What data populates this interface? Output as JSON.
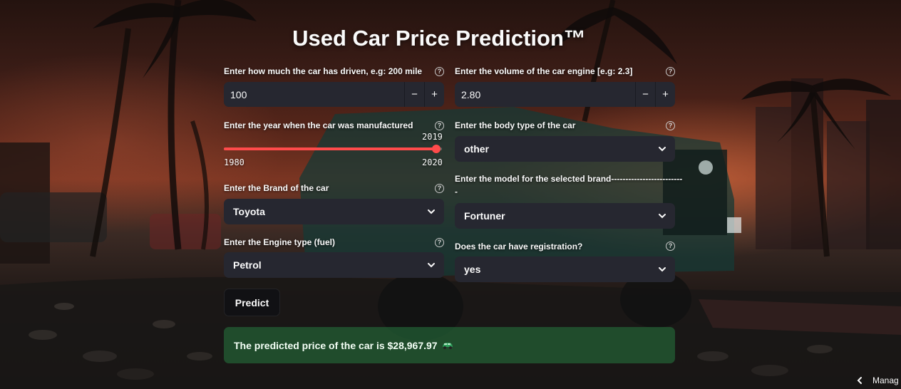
{
  "app": {
    "title": "Used Car Price Prediction™"
  },
  "fields": {
    "mileage": {
      "label": "Enter how much the car has driven, e.g: 200 mile",
      "value": "100",
      "minus": "−",
      "plus": "+"
    },
    "engine_volume": {
      "label": "Enter the volume of the car engine [e.g: 2.3]",
      "value": "2.80",
      "minus": "−",
      "plus": "+"
    },
    "year": {
      "label": "Enter the year when the car was manufactured",
      "value": "2019",
      "min": "1980",
      "max": "2020",
      "fraction": 0.975
    },
    "body_type": {
      "label": "Enter the body type of the car",
      "value": "other"
    },
    "brand": {
      "label": "Enter the Brand of the car",
      "value": "Toyota"
    },
    "model": {
      "label": "Enter the model for the selected brand-------------------------",
      "label_cont": "-",
      "value": "Fortuner"
    },
    "engine_type": {
      "label": "Enter the Engine type (fuel)",
      "value": "Petrol"
    },
    "registration": {
      "label": "Does the car have registration?",
      "value": "yes"
    }
  },
  "predict_button": "Predict",
  "result": {
    "text": "The predicted price of the car is $28,967.97",
    "icon": "green-car-icon"
  },
  "footer": {
    "manage_label": "Manag",
    "icon": "chevron-left-icon"
  },
  "colors": {
    "accent": "#ff4b4b",
    "widget_bg": "#262730",
    "success": "#2e7d4a"
  }
}
